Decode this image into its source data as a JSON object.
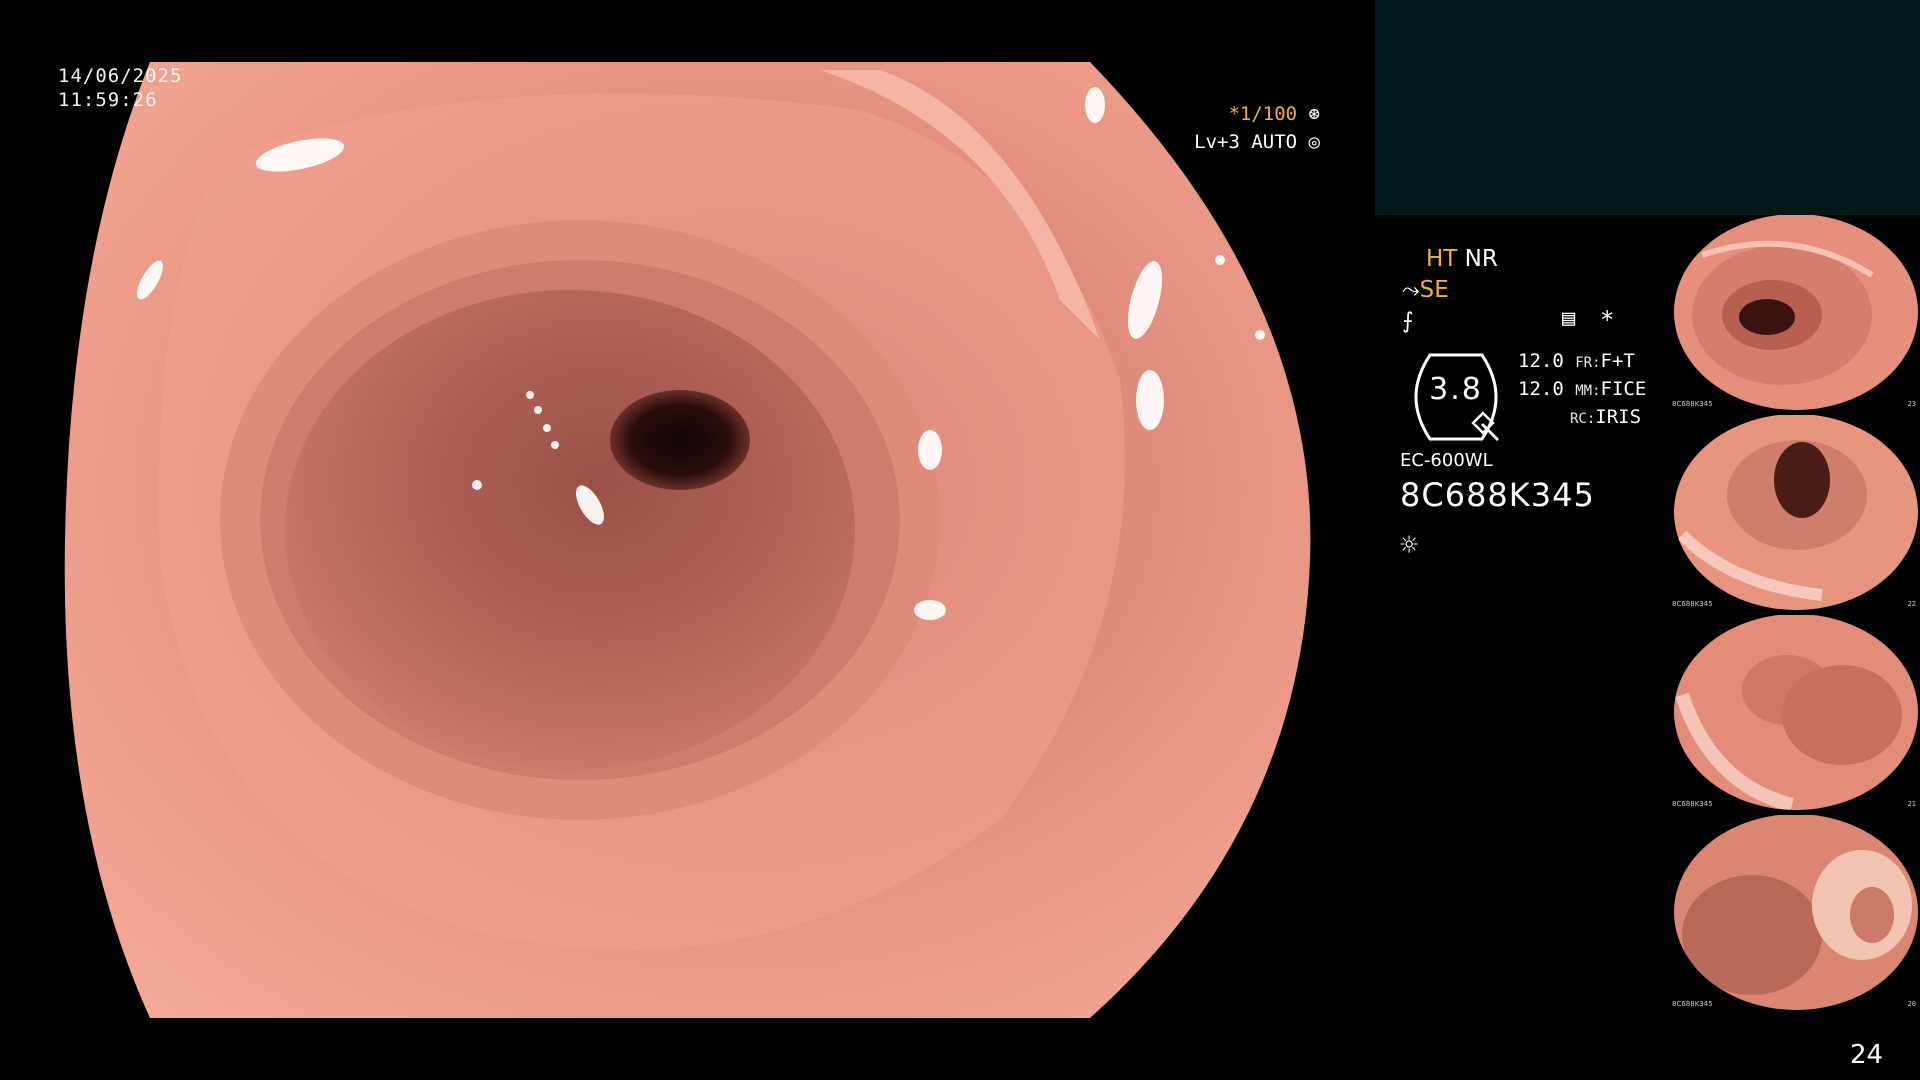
{
  "overlay": {
    "date": "14/06/2025",
    "time": "11:59:26",
    "shutter_speed": "*1/100",
    "light_level": "Lv+3 AUTO"
  },
  "processor": {
    "ht_label": "HT",
    "nr_label": "NR",
    "se_label": "SE",
    "iris_value": "3.8",
    "params": [
      {
        "value": "12.0",
        "label": "FR:",
        "mode": "F+T"
      },
      {
        "value": "12.0",
        "label": "MM:",
        "mode": "FICE"
      },
      {
        "value": "",
        "label": "RC:",
        "mode": "IRIS"
      }
    ],
    "scope_model": "EC-600WL",
    "scope_serial": "8C688K345"
  },
  "thumbnails": [
    {
      "caption_serial": "8C688K345",
      "index": "23"
    },
    {
      "caption_serial": "8C688K345",
      "index": "22"
    },
    {
      "caption_serial": "8C688K345",
      "index": "21"
    },
    {
      "caption_serial": "8C688K345",
      "index": "20"
    }
  ],
  "page_number": "24",
  "colors": {
    "accent_yellow": "#f0b040",
    "info_panel_bg": "#02191a",
    "mucosa": "#e8907f"
  },
  "icons": [
    "aperture-icon",
    "target-icon",
    "scope-tip-icon",
    "structure-icon",
    "memo-icon",
    "asterisk-icon",
    "brightness-icon"
  ]
}
